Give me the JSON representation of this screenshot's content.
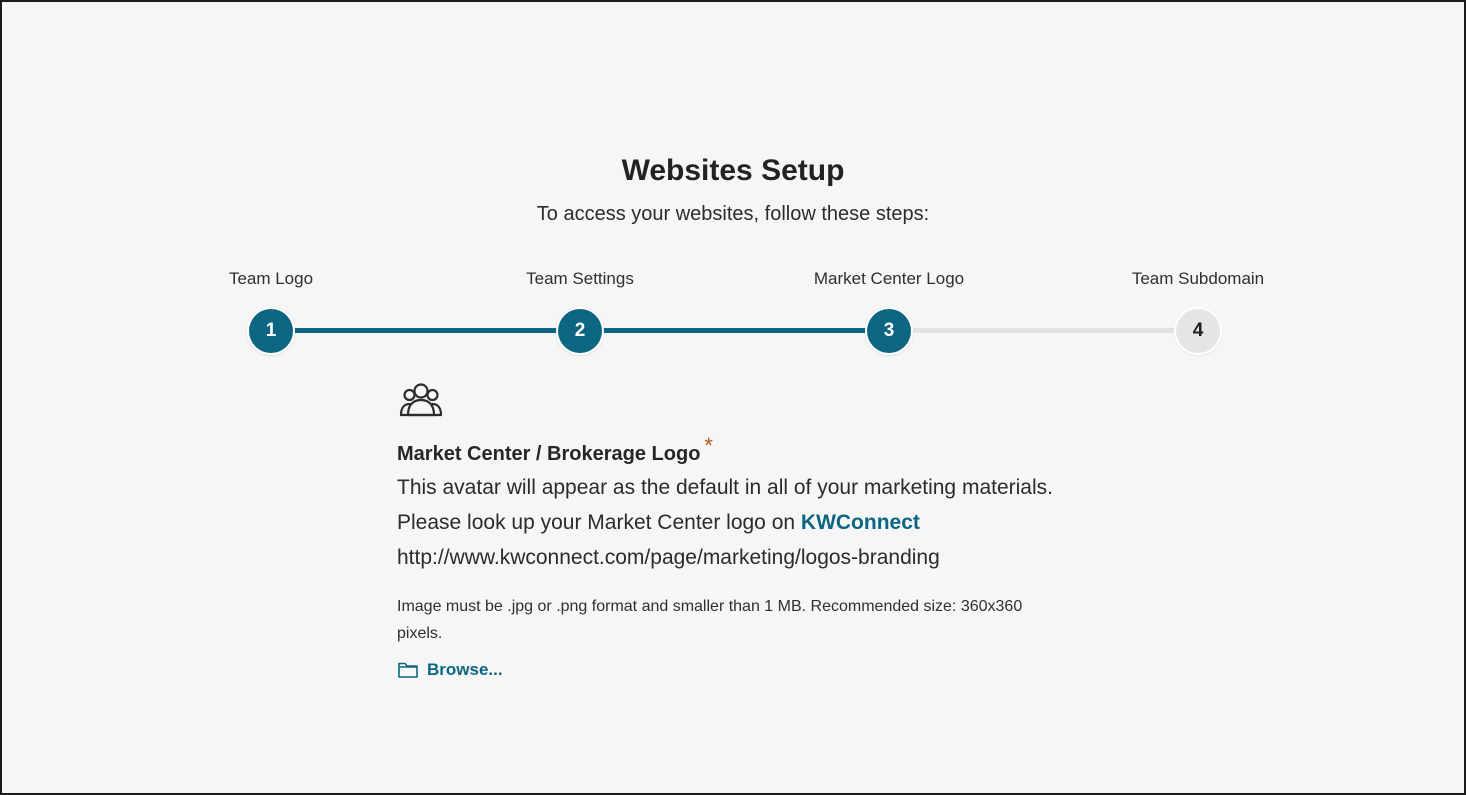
{
  "header": {
    "title": "Websites Setup",
    "subtitle": "To access your websites, follow these steps:"
  },
  "stepper": {
    "steps": [
      {
        "label": "Team Logo",
        "number": "1",
        "status": "complete"
      },
      {
        "label": "Team Settings",
        "number": "2",
        "status": "complete"
      },
      {
        "label": "Market Center Logo",
        "number": "3",
        "status": "current"
      },
      {
        "label": "Team Subdomain",
        "number": "4",
        "status": "pending"
      }
    ],
    "colors": {
      "active": "#0c6681",
      "inactive": "#e2e3e5"
    }
  },
  "logo_field": {
    "icon": "team-group-icon",
    "title": "Market Center / Brokerage Logo",
    "required_mark": "*",
    "description_prefix": "This avatar will appear as the default in all of your marketing materials. Please look up your Market Center logo on ",
    "link_text": "KWConnect",
    "url_text": "http://www.kwconnect.com/page/marketing/logos-branding",
    "hint": "Image must be .jpg or .png format and smaller than 1 MB. Recommended size: 360x360 pixels.",
    "browse_label": "Browse...",
    "browse_icon": "folder-icon"
  }
}
